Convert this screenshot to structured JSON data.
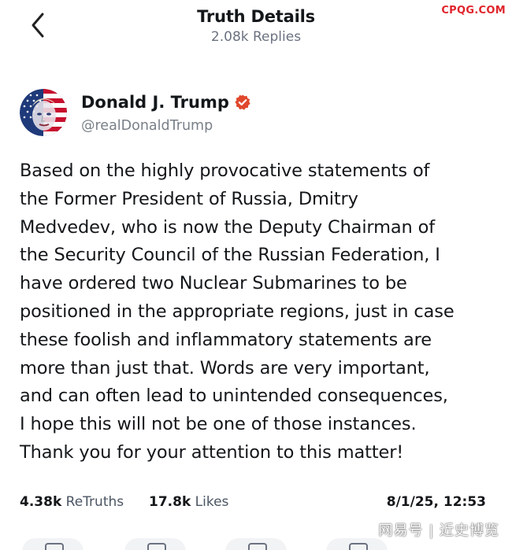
{
  "header": {
    "title": "Truth Details",
    "subtitle": "2.08k Replies"
  },
  "watermark_top": "CPQG.COM",
  "author": {
    "name": "Donald J. Trump",
    "handle": "@realDonaldTrump",
    "verified": true,
    "avatar_icon": "avatar-flag-portrait"
  },
  "post": {
    "lines": [
      "Based on the highly provocative statements of",
      "the Former President of Russia, Dmitry",
      "Medvedev, who is now the Deputy Chairman of",
      "the Security Council of the Russian Federation, I",
      "have ordered two Nuclear Submarines to be",
      "positioned in the appropriate regions, just in case",
      "these foolish and inflammatory statements are",
      "more than just that. Words are very important,",
      "and can often lead to unintended consequences,",
      "I hope this will not be one of those instances.",
      "Thank you for your attention to this matter!"
    ]
  },
  "stats": {
    "retruths_count": "4.38k",
    "retruths_label": "ReTruths",
    "likes_count": "17.8k",
    "likes_label": "Likes",
    "date": "8/1/25, 12:53"
  },
  "watermark_bottom": "网易号 | 近史博览",
  "colors": {
    "verified_badge": "#e0472b",
    "watermark_red": "#e0242c",
    "text_primary": "#14171a",
    "text_secondary": "#6b7280"
  }
}
